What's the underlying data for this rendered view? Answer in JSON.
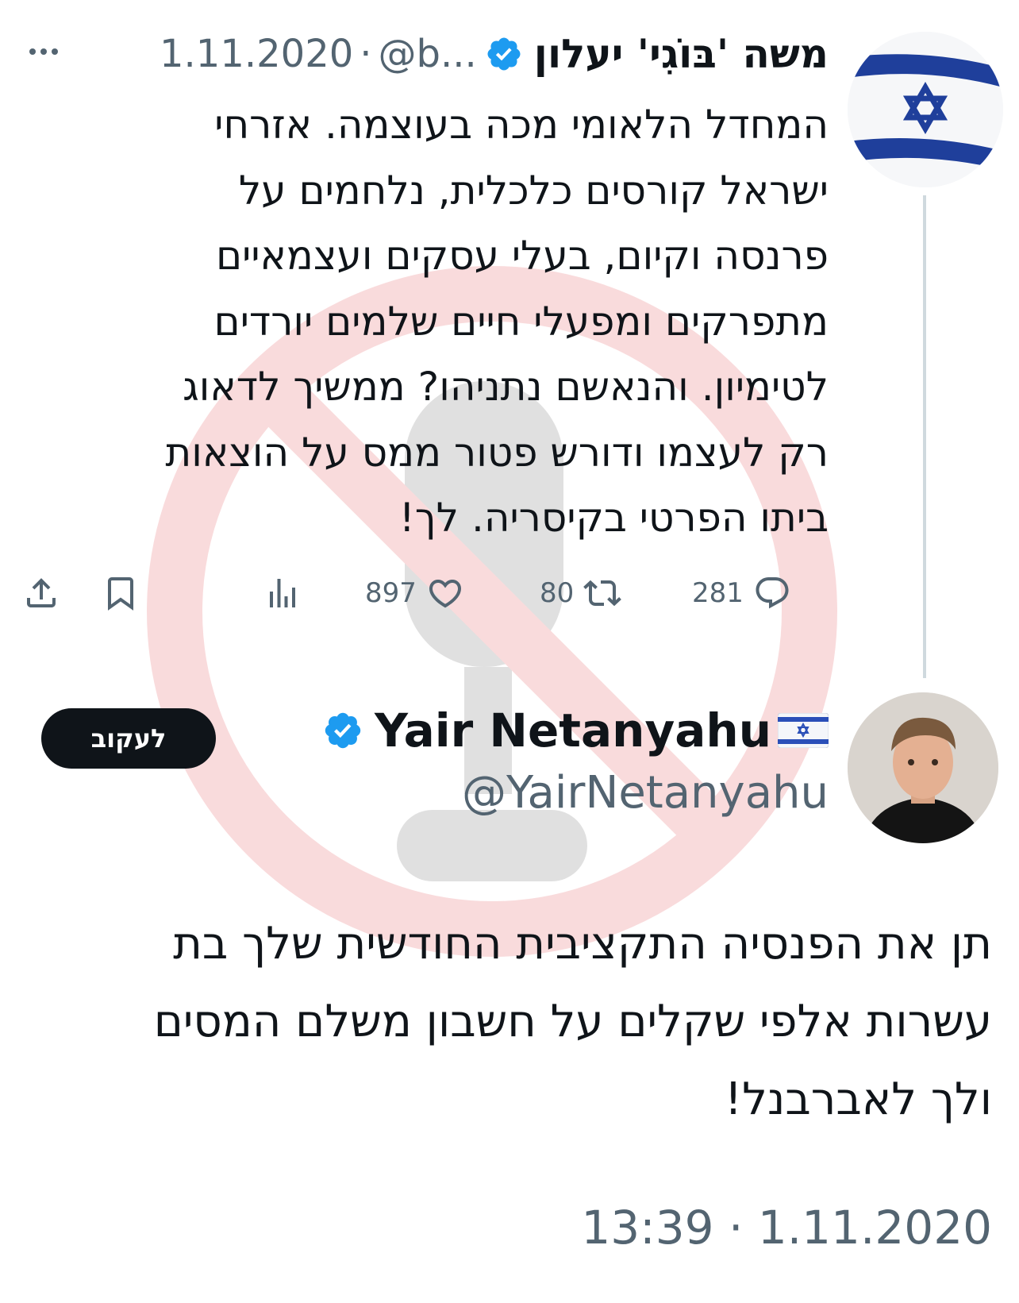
{
  "quoted_tweet": {
    "author_name": "משה 'בּוֹגִי' יעלון",
    "handle": "@b...",
    "separator": "·",
    "date": "1.11.2020",
    "avatar": "israel-flag",
    "lines": [
      "המחדל הלאומי מכה בעוצמה. אזרחי",
      "ישראל קורסים כלכלית, נלחמים על",
      "פרנסה וקיום, בעלי עסקים ועצמאיים",
      "מתפרקים ומפעלי חיים שלמים יורדים",
      "לטימיון. והנאשם נתניהו? ממשיך לדאוג",
      "רק לעצמו ודורש פטור ממס על הוצאות",
      "ביתו הפרטי בקיסריה. לך!"
    ],
    "counts": {
      "replies": "281",
      "retweets": "80",
      "likes": "897"
    }
  },
  "reply_tweet": {
    "author_name": "Yair Netanyahu",
    "handle": "@YairNetanyahu",
    "follow_label": "לעקוב",
    "lines": [
      "תן את הפנסיה התקציבית החודשית שלך בת",
      "עשרות אלפי שקלים על חשבון משלם המסים",
      "ולך לאברבנל!"
    ],
    "timestamp": "13:39 · 1.11.2020"
  },
  "colors": {
    "verified": "#1d9bf0",
    "secondary_text": "#536471",
    "watermark": "#e0242b"
  },
  "icons": [
    "more-icon",
    "verified-badge-icon",
    "reply-icon",
    "retweet-icon",
    "like-icon",
    "views-icon",
    "bookmark-icon",
    "share-icon",
    "israel-flag-icon"
  ]
}
